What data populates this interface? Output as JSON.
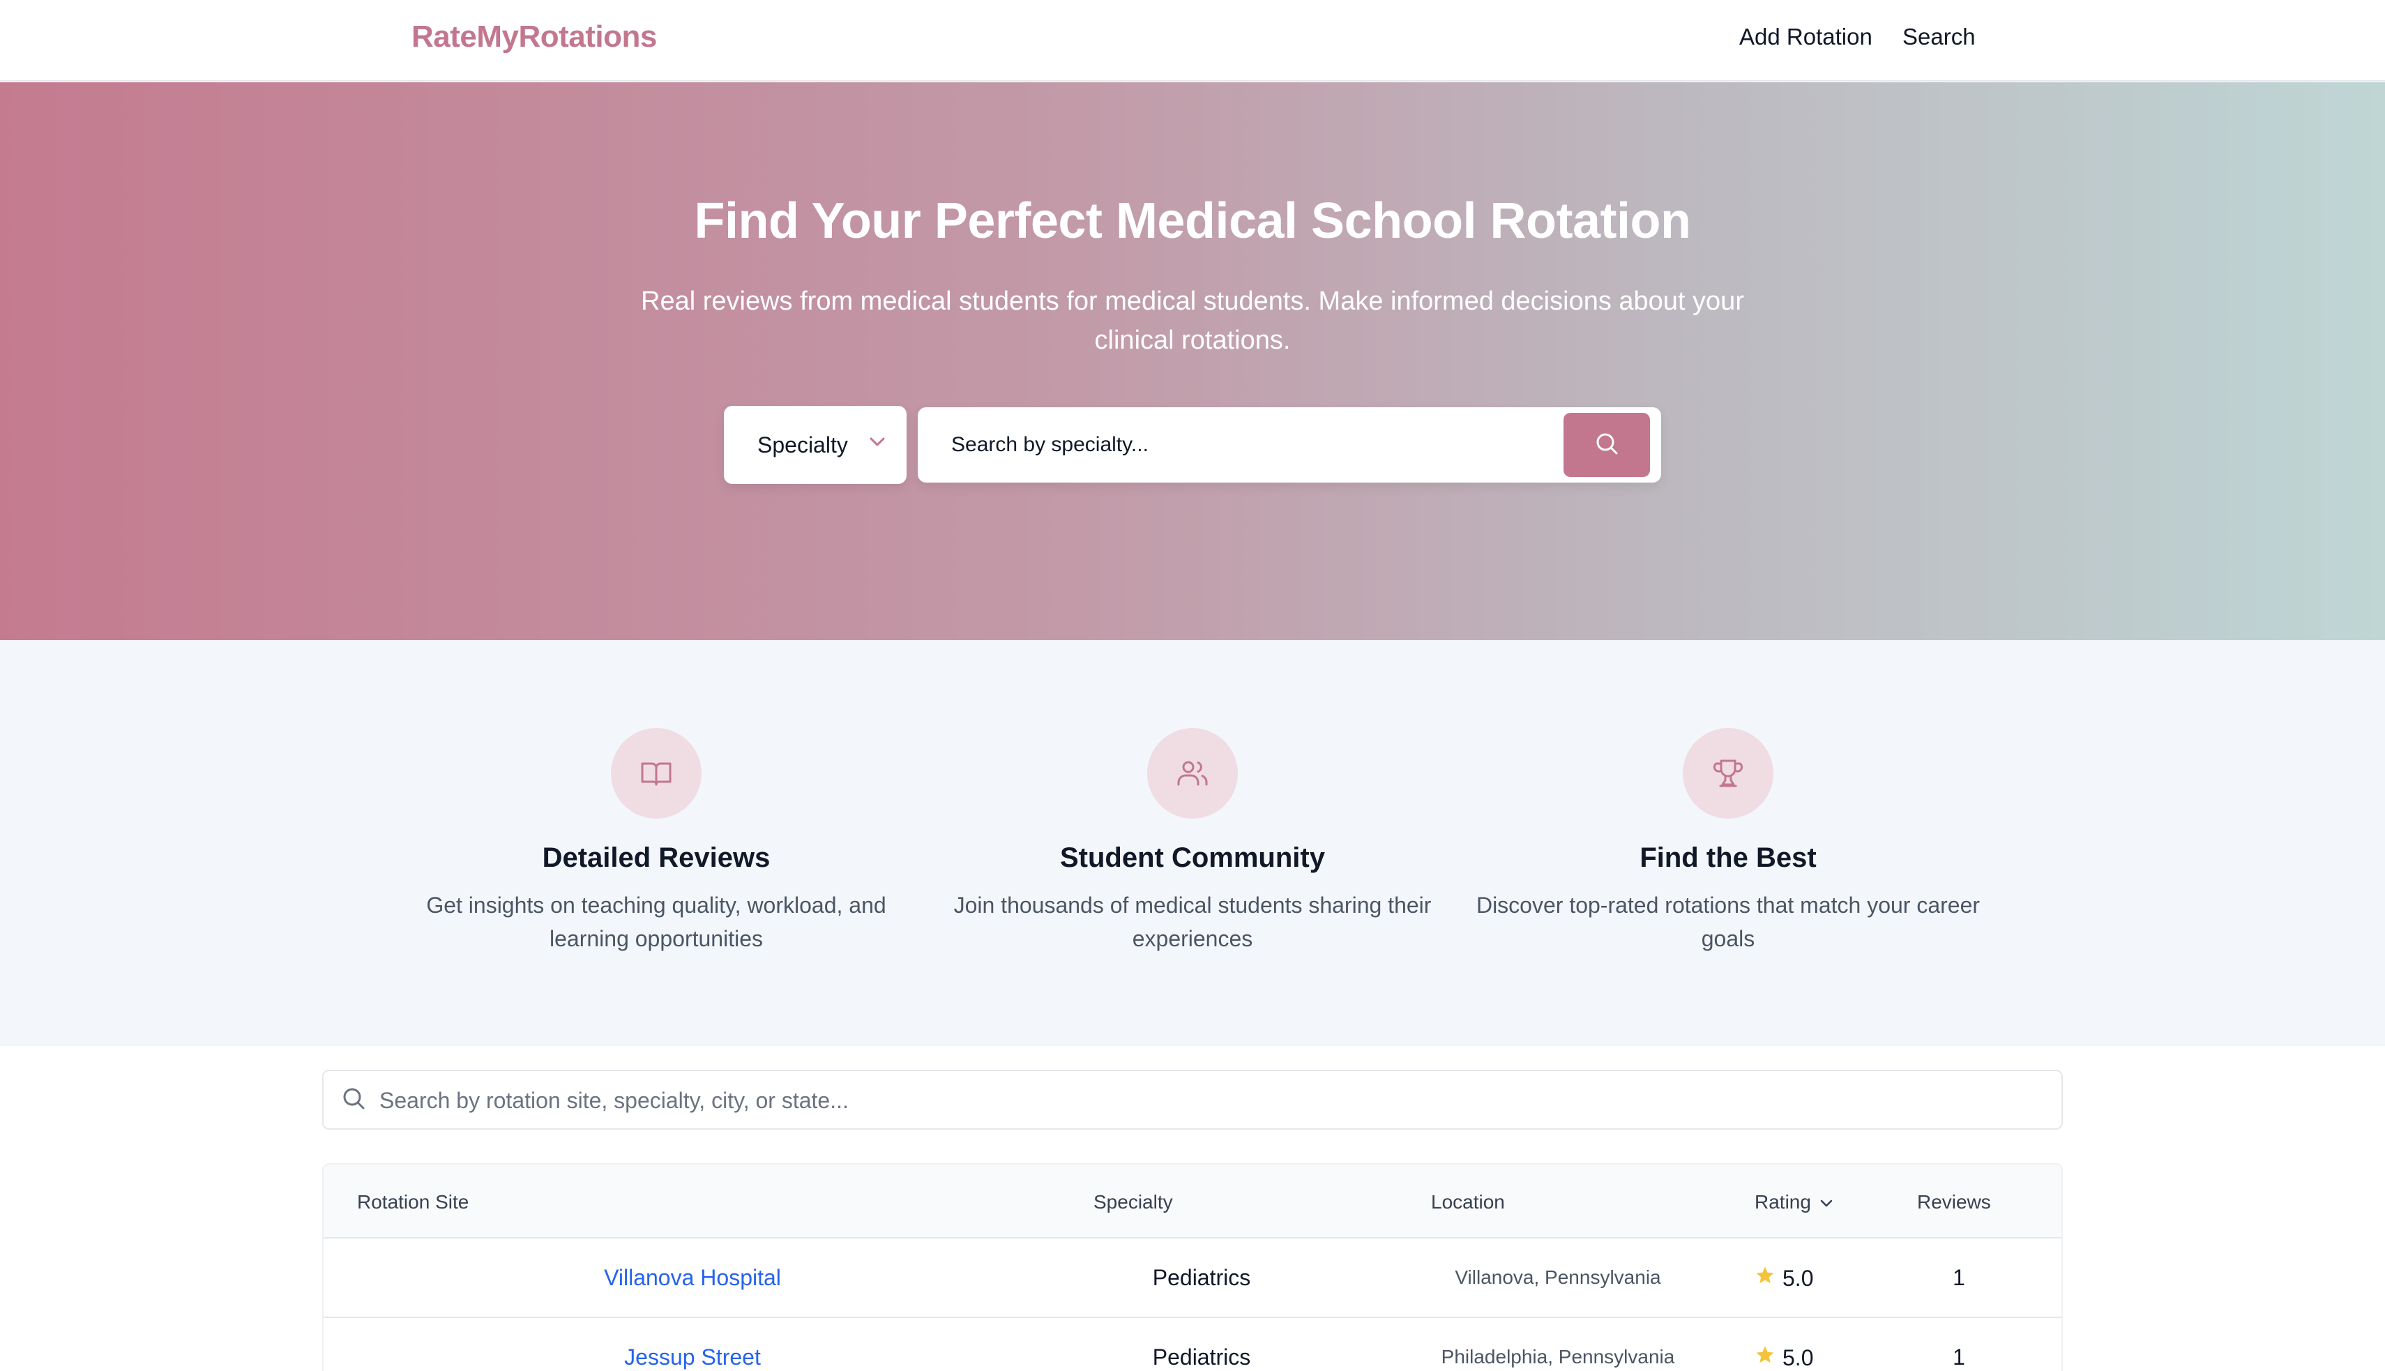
{
  "navbar": {
    "brand": "RateMyRotations",
    "links": [
      "Add Rotation",
      "Search"
    ]
  },
  "hero": {
    "title": "Find Your Perfect Medical School Rotation",
    "subtitle": "Real reviews from medical students for medical students. Make informed decisions about your clinical rotations.",
    "filter_select": "Specialty",
    "search_placeholder": "Search by specialty..."
  },
  "features": [
    {
      "icon": "book-open-icon",
      "title": "Detailed Reviews",
      "description": "Get insights on teaching quality, workload, and learning opportunities"
    },
    {
      "icon": "users-icon",
      "title": "Student Community",
      "description": "Join thousands of medical students sharing their experiences"
    },
    {
      "icon": "trophy-icon",
      "title": "Find the Best",
      "description": "Discover top-rated rotations that match your career goals"
    }
  ],
  "table_search": {
    "placeholder": "Search by rotation site, specialty, city, or state..."
  },
  "table": {
    "columns": [
      "Rotation Site",
      "Specialty",
      "Location",
      "Rating",
      "Reviews"
    ],
    "sorted_column": "Rating",
    "rows": [
      {
        "site": "Villanova Hospital",
        "specialty": "Pediatrics",
        "location": "Villanova, Pennsylvania",
        "rating": "5.0",
        "reviews": "1"
      },
      {
        "site": "Jessup Street",
        "specialty": "Pediatrics",
        "location": "Philadelphia, Pennsylvania",
        "rating": "5.0",
        "reviews": "1"
      }
    ]
  },
  "colors": {
    "brand": "#c2778f",
    "link": "#2563eb",
    "star": "#f5c33b",
    "feature_bg": "#f3f7fb"
  }
}
